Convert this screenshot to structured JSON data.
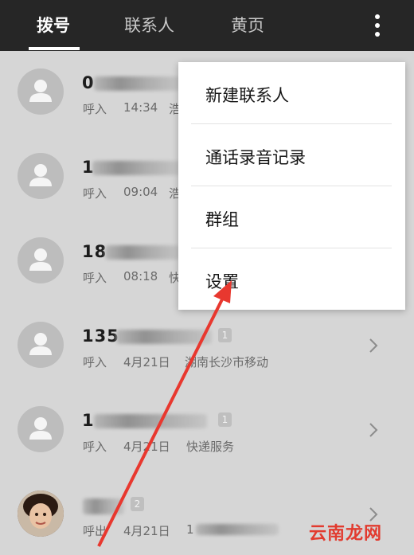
{
  "tabs": [
    {
      "label": "拨号",
      "active": true
    },
    {
      "label": "联系人",
      "active": false
    },
    {
      "label": "黄页",
      "active": false
    }
  ],
  "calls": [
    {
      "number": "0",
      "badge": "",
      "type": "呼入",
      "time": "14:34",
      "location": "浩"
    },
    {
      "number": "1",
      "badge": "",
      "type": "呼入",
      "time": "09:04",
      "location": "浩"
    },
    {
      "number": "18",
      "badge": "",
      "type": "呼入",
      "time": "08:18",
      "location": "快"
    },
    {
      "number": "135",
      "badge": "1",
      "type": "呼入",
      "time": "4月21日",
      "location": "湖南长沙市移动"
    },
    {
      "number": "1",
      "badge": "1",
      "type": "呼入",
      "time": "4月21日",
      "location": "快递服务"
    },
    {
      "number": "",
      "badge": "2",
      "type": "呼出",
      "time": "4月21日",
      "location": "1"
    }
  ],
  "menu": {
    "items": [
      {
        "label": "新建联系人"
      },
      {
        "label": "通话录音记录"
      },
      {
        "label": "群组"
      },
      {
        "label": "设置"
      }
    ]
  },
  "watermark": "云南龙网",
  "colors": {
    "topbar": "#262626",
    "arrow": "#e8382f"
  }
}
